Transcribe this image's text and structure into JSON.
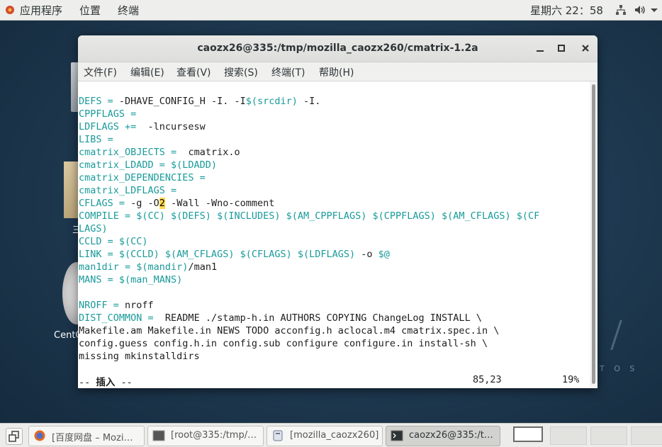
{
  "topbar": {
    "applications": "应用程序",
    "places": "位置",
    "terminal": "终端",
    "clock": "星期六 22：58"
  },
  "desktop": {
    "folder_label": "三",
    "dvd_label": "CentC",
    "logo_text": "T O S"
  },
  "window": {
    "title": "caozx26@335:/tmp/mozilla_caozx260/cmatrix-1.2a",
    "menu": [
      "文件(F)",
      "编辑(E)",
      "查看(V)",
      "搜索(S)",
      "终端(T)",
      "帮助(H)"
    ]
  },
  "editor": {
    "lines": [
      [
        "DEFS = ",
        "-DHAVE_CONFIG_H -I. -I",
        "$(srcdir)",
        " -I."
      ],
      [
        "CPPFLAGS =",
        "",
        "",
        ""
      ],
      [
        "LDFLAGS += ",
        " -lncursesw",
        "",
        ""
      ],
      [
        "LIBS =",
        "",
        "",
        ""
      ],
      [
        "cmatrix_OBJECTS = ",
        " cmatrix.o",
        "",
        ""
      ],
      [
        "cmatrix_LDADD = $(LDADD)",
        "",
        "",
        ""
      ],
      [
        "cmatrix_DEPENDENCIES =",
        "",
        "",
        ""
      ],
      [
        "cmatrix_LDFLAGS =",
        "",
        "",
        ""
      ],
      [
        "CFLAGS = ",
        "-g -O",
        "2",
        " -Wall -Wno-comment"
      ],
      [
        "COMPILE = $(CC) $(DEFS) $(INCLUDES) $(AM_CPPFLAGS) $(CPPFLAGS) $(AM_CFLAGS) $(CF",
        "",
        "",
        ""
      ],
      [
        "LAGS)",
        "",
        "",
        ""
      ],
      [
        "CCLD = $(CC)",
        "",
        "",
        ""
      ],
      [
        "LINK = $(CCLD) $(AM_CFLAGS) $(CFLAGS) $(LDFLAGS) ",
        "-o ",
        "$@",
        ""
      ],
      [
        "man1dir = $(mandir)",
        "/man1",
        "",
        ""
      ],
      [
        "MANS = $(man_MANS)",
        "",
        "",
        ""
      ],
      [
        "",
        "",
        "",
        ""
      ],
      [
        "NROFF = ",
        "nroff",
        "",
        ""
      ],
      [
        "DIST_COMMON = ",
        " README ./stamp-h.in AUTHORS COPYING ChangeLog INSTALL \\",
        "",
        ""
      ],
      [
        "",
        "Makefile.am Makefile.in NEWS TODO acconfig.h aclocal.m4 cmatrix.spec.in \\",
        "",
        ""
      ],
      [
        "",
        "config.guess config.h.in config.sub configure configure.in install-sh \\",
        "",
        ""
      ],
      [
        "",
        "missing mkinstalldirs",
        "",
        ""
      ]
    ],
    "mode_prefix": "-- ",
    "mode": "插入",
    "mode_suffix": " --",
    "position": "85,23",
    "percent": "19%"
  },
  "taskbar": {
    "tasks": [
      "[百度网盘 – Mozi…",
      "[root@335:/tmp/…",
      "[mozilla_caozx260]",
      "caozx26@335:/t…"
    ]
  },
  "colors": {
    "keyword": "#1a9a9a",
    "text": "#1e1e1e",
    "cursor": "#ffd84a"
  }
}
